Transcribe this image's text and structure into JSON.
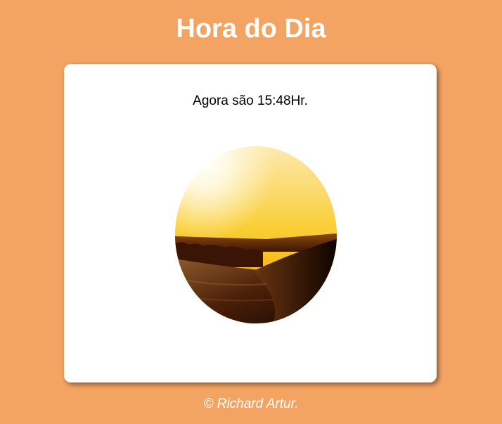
{
  "header": {
    "title": "Hora do Dia"
  },
  "card": {
    "message": "Agora são 15:48Hr.",
    "image": {
      "subject": "afternoon-desert-sunset",
      "sky_color": "#f9c21a",
      "dune_color": "#2a0e03"
    }
  },
  "footer": {
    "credit": "© Richard Artur."
  },
  "theme": {
    "background": "#f3a463",
    "card": "#ffffff",
    "title_text": "#ffffff"
  }
}
